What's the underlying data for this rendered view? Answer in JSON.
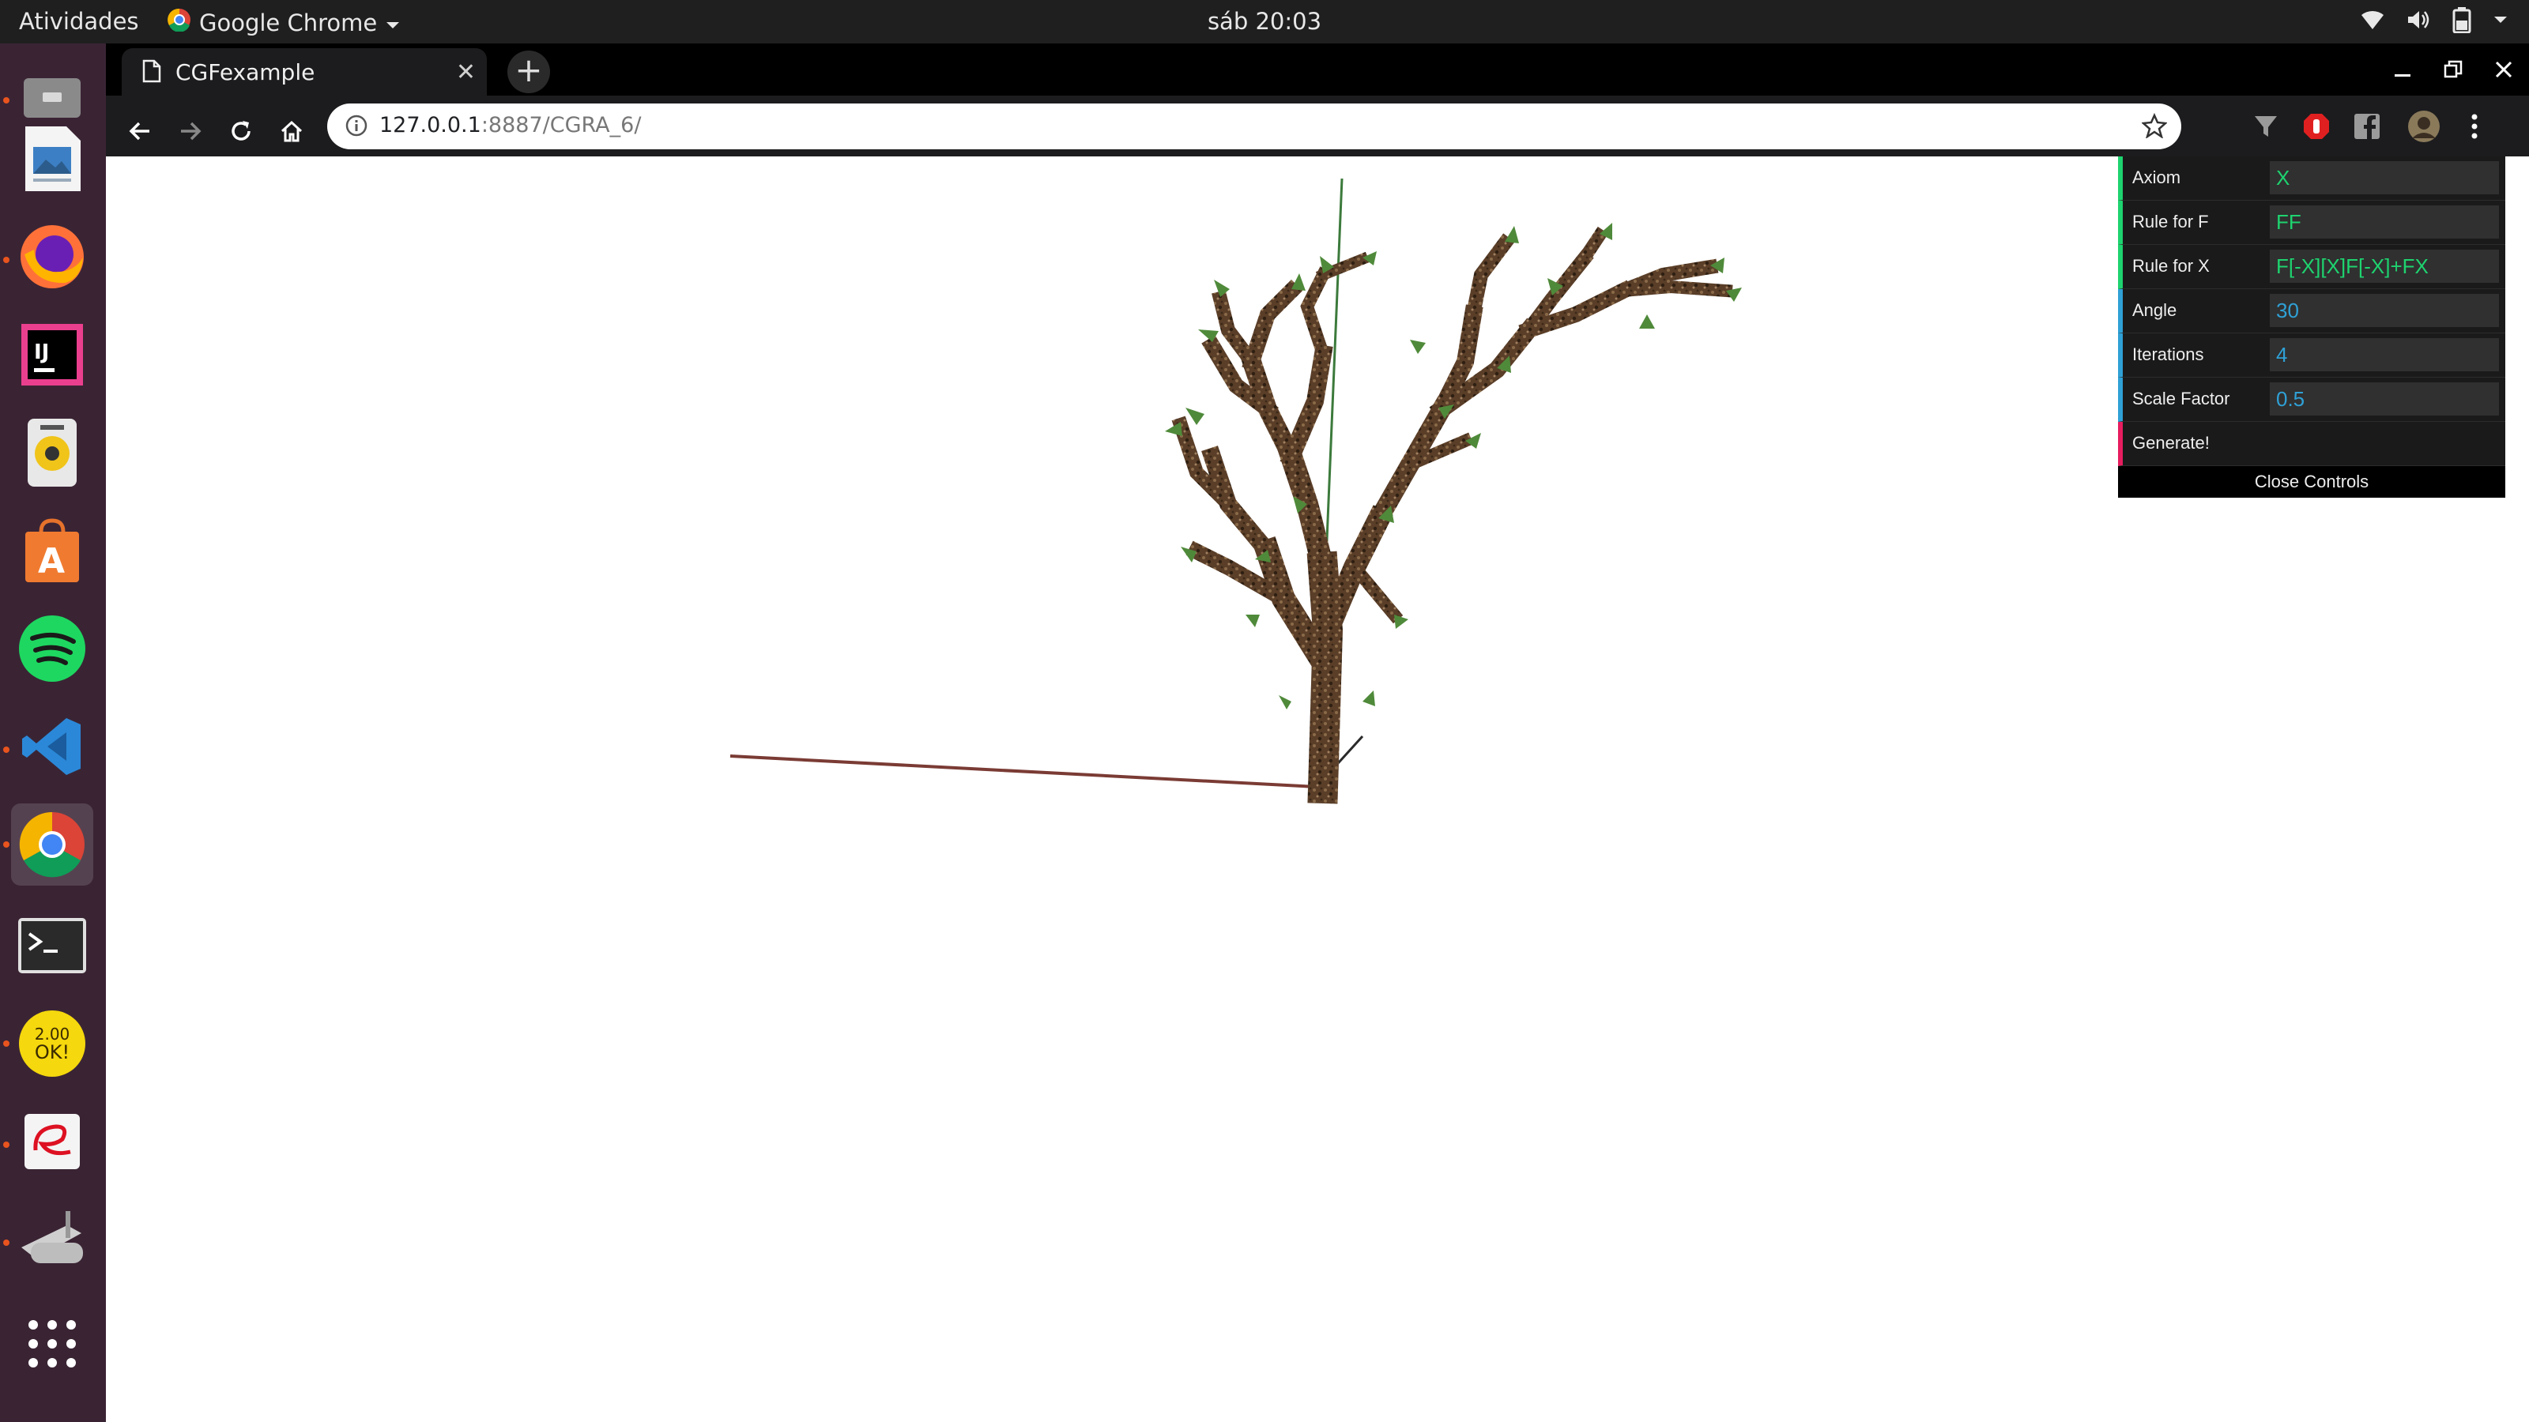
{
  "topbar": {
    "activities": "Atividades",
    "app_name": "Google Chrome",
    "clock": "sáb 20:03",
    "tray_icons": [
      "wifi-icon",
      "volume-icon",
      "battery-icon",
      "system-menu-caret-icon"
    ]
  },
  "dock": {
    "items": [
      {
        "name": "files-icon",
        "active": false
      },
      {
        "name": "image-viewer-icon",
        "active": false
      },
      {
        "name": "firefox-icon",
        "active": false
      },
      {
        "name": "intellij-icon",
        "active": false
      },
      {
        "name": "rhythmbox-icon",
        "active": false
      },
      {
        "name": "software-center-icon",
        "active": false
      },
      {
        "name": "spotify-icon",
        "active": false
      },
      {
        "name": "vscode-icon",
        "active": false
      },
      {
        "name": "chrome-icon",
        "active": true
      },
      {
        "name": "terminal-icon",
        "active": false
      },
      {
        "name": "2048-game-icon",
        "active": false
      },
      {
        "name": "evince-icon",
        "active": false
      },
      {
        "name": "scanner-icon",
        "active": false
      },
      {
        "name": "show-applications-icon",
        "active": false
      }
    ],
    "game_icon_text": "2.00\nOK!"
  },
  "browser": {
    "tab_title": "CGFexample",
    "url_host": "127.0.0.1",
    "url_rest": ":8887/CGRA_6/",
    "extensions": [
      "filter-extension-icon",
      "adblock-extension-icon",
      "facebook-extension-icon",
      "profile-avatar-icon"
    ]
  },
  "gui": {
    "rows": [
      {
        "label": "Axiom",
        "value": "X",
        "type": "string"
      },
      {
        "label": "Rule for F",
        "value": "FF",
        "type": "string"
      },
      {
        "label": "Rule for X",
        "value": "F[-X][X]F[-X]+FX",
        "type": "string"
      },
      {
        "label": "Angle",
        "value": "30",
        "type": "number"
      },
      {
        "label": "Iterations",
        "value": "4",
        "type": "number"
      },
      {
        "label": "Scale Factor",
        "value": "0.5",
        "type": "number"
      },
      {
        "label": "Generate!",
        "value": "",
        "type": "function"
      }
    ],
    "close_label": "Close Controls"
  },
  "colors": {
    "bark": "#5a3e28",
    "bark_dark": "#3b2818",
    "leaf": "#4f8a3a",
    "x_axis": "#7a3b34",
    "y_axis": "#3c7a3c",
    "gui_string": "#1ed36f",
    "gui_number": "#2fa1d6",
    "gui_function": "#e61d5f"
  }
}
